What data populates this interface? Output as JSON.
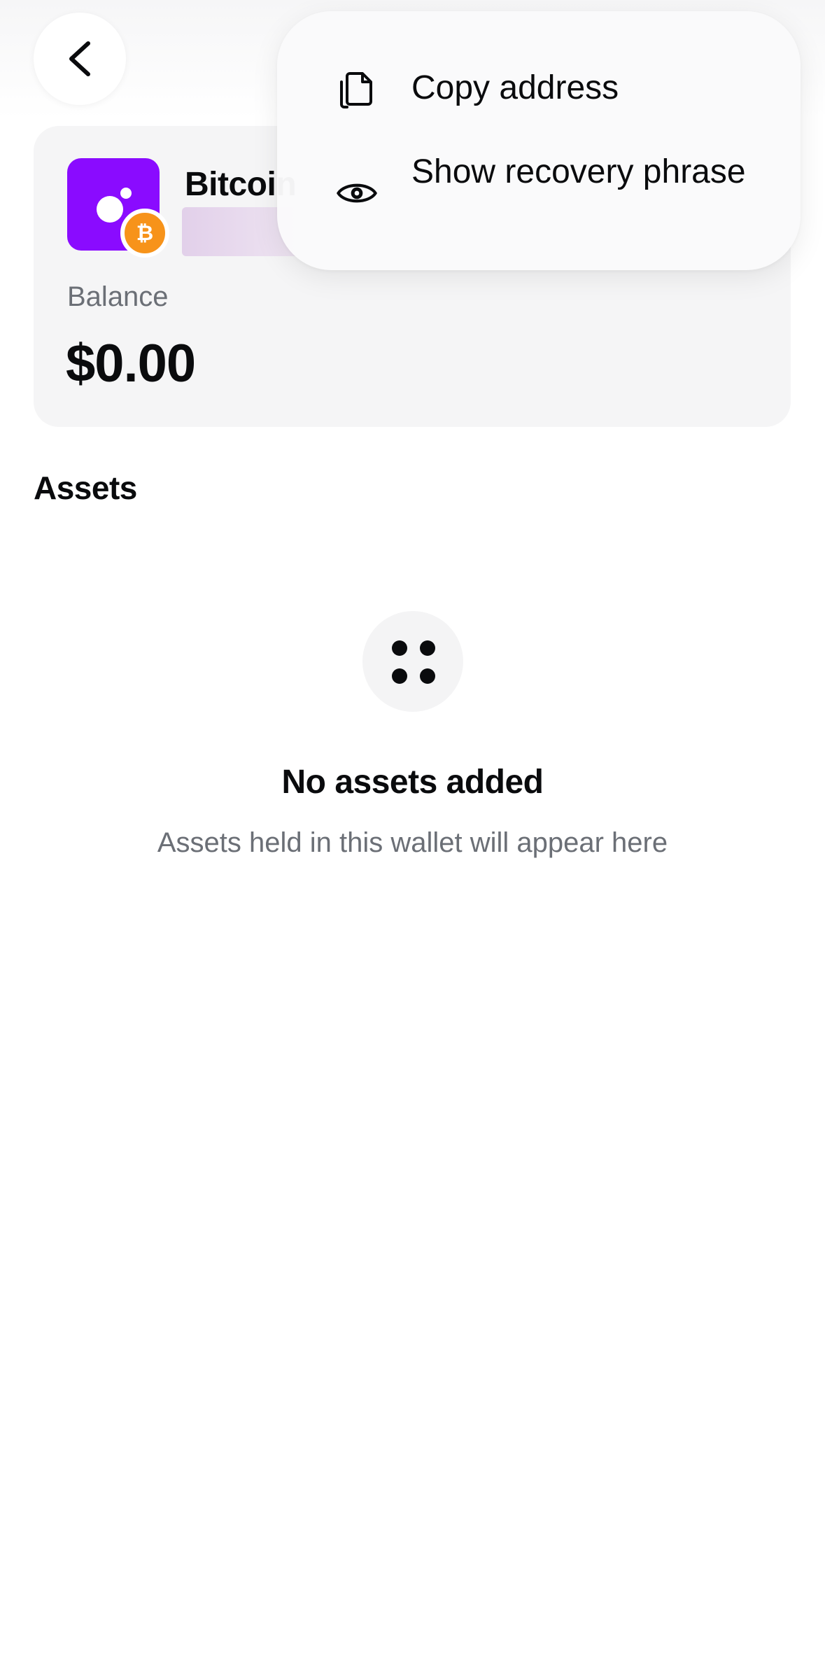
{
  "wallet": {
    "name": "Bitcoin",
    "balance_label": "Balance",
    "balance_value": "$0.00",
    "brand_color": "#8a0bff",
    "badge_color": "#f7931a",
    "badge_symbol": "₿"
  },
  "assets": {
    "heading": "Assets",
    "empty_title": "No assets added",
    "empty_subtitle": "Assets held in this wallet will appear here"
  },
  "menu": {
    "items": [
      {
        "label": "Copy address",
        "icon": "copy-icon"
      },
      {
        "label": "Show recovery phrase",
        "icon": "eye-icon"
      }
    ]
  },
  "nav": {
    "back_icon": "chevron-left-icon"
  }
}
